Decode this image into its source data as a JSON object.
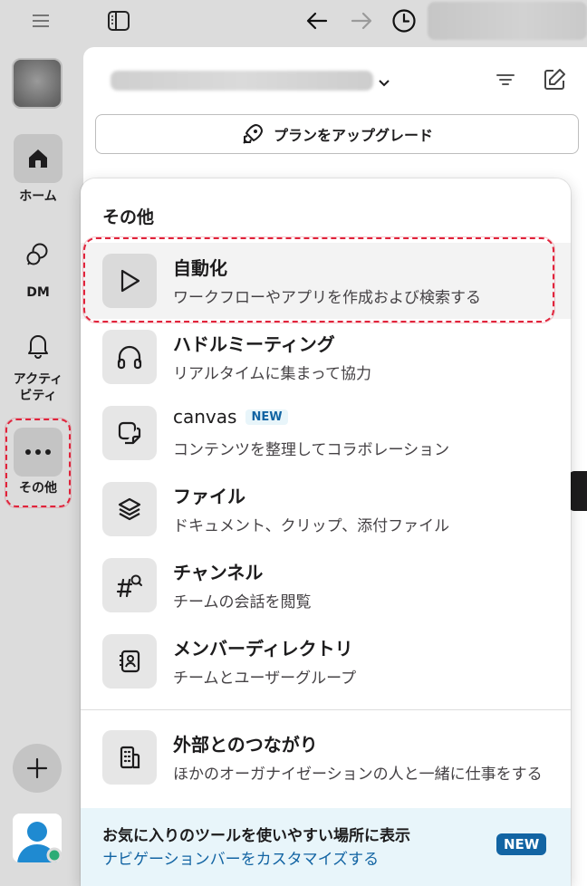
{
  "rail": {
    "home_label": "ホーム",
    "dm_label": "DM",
    "activity_label": "アクティ\nビティ",
    "more_label": "その他"
  },
  "main": {
    "upgrade_label": "プランをアップグレード"
  },
  "popup": {
    "title": "その他",
    "items": [
      {
        "title": "自動化",
        "desc": "ワークフローやアプリを作成および検索する",
        "icon": "play-icon"
      },
      {
        "title": "ハドルミーティング",
        "desc": "リアルタイムに集まって協力",
        "icon": "headphones-icon"
      },
      {
        "title": "canvas",
        "badge": "NEW",
        "desc": "コンテンツを整理してコラボレーション",
        "icon": "canvas-icon"
      },
      {
        "title": "ファイル",
        "desc": "ドキュメント、クリップ、添付ファイル",
        "icon": "layers-icon"
      },
      {
        "title": "チャンネル",
        "desc": "チームの会話を閲覧",
        "icon": "channel-search-icon"
      },
      {
        "title": "メンバーディレクトリ",
        "desc": "チームとユーザーグループ",
        "icon": "contact-book-icon"
      },
      {
        "title": "外部とのつながり",
        "desc": "ほかのオーガナイゼーションの人と一緒に仕事をする",
        "icon": "building-icon"
      }
    ],
    "footer": {
      "text": "お気に入りのツールを使いやすい場所に表示",
      "link": "ナビゲーションバーをカスタマイズする",
      "badge": "NEW"
    }
  },
  "colors": {
    "accent_blue": "#1264a3",
    "highlight_red": "#e0233b",
    "footer_bg": "#e8f5fa"
  }
}
